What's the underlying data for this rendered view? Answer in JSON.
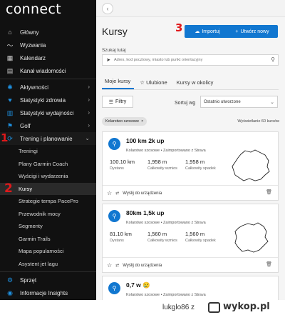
{
  "app": {
    "logo": "connect"
  },
  "sidebar": {
    "items": [
      {
        "label": "Główny",
        "icon": "home-icon",
        "glyph": "⌂"
      },
      {
        "label": "Wyzwania",
        "icon": "trend-icon",
        "glyph": "〜"
      },
      {
        "label": "Kalendarz",
        "icon": "calendar-icon",
        "glyph": "▦"
      },
      {
        "label": "Kanał wiadomości",
        "icon": "news-icon",
        "glyph": "▤"
      }
    ],
    "groups": [
      {
        "label": "Aktywności",
        "icon": "runner-icon",
        "glyph": "✱",
        "chevron": "›"
      },
      {
        "label": "Statystyki zdrowia",
        "icon": "heart-icon",
        "glyph": "♥",
        "chevron": "›"
      },
      {
        "label": "Statystyki wydajności",
        "icon": "chart-icon",
        "glyph": "▥",
        "chevron": "›"
      },
      {
        "label": "Golf",
        "icon": "golf-flag-icon",
        "glyph": "⚑",
        "chevron": "›"
      }
    ],
    "training": {
      "label": "Trening i planowanie",
      "icon": "training-icon",
      "glyph": "⟳",
      "chevron": "⌄",
      "marker": "1",
      "sub_items": [
        "Treningi",
        "Plany Garmin Coach",
        "Wyścigi i wydarzenia",
        "Kursy",
        "Strategie tempa PacePro",
        "Przewodnik mocy",
        "Segmenty",
        "Garmin Trails",
        "Mapa popularności",
        "Asystent jet lagu"
      ],
      "active_marker": "2"
    },
    "bottom": [
      {
        "label": "Sprzęt",
        "icon": "gear-icon",
        "glyph": "⚙"
      },
      {
        "label": "Informacje Insights",
        "icon": "insights-icon",
        "glyph": "◉"
      }
    ]
  },
  "topbar": {
    "back_glyph": "‹"
  },
  "page": {
    "title": "Kursy",
    "import_marker": "3",
    "import_label": "Importuj",
    "new_label": "Utwórz nowy",
    "new_glyph": "+",
    "import_glyph": "☁"
  },
  "search": {
    "label": "Szukaj tutaj",
    "placeholder": "Adres, kod pocztowy, miasto lub punkt orientacyjny",
    "loc_glyph": "➤",
    "lens_glyph": "⚲"
  },
  "tabs": [
    {
      "label": "Moje kursy",
      "active": true
    },
    {
      "label": "☆ Ulubione",
      "active": false
    },
    {
      "label": "Kursy w okolicy",
      "active": false
    }
  ],
  "filters": {
    "label": "Filtry",
    "glyph": "☰"
  },
  "sort": {
    "label": "Sortuj wg",
    "value": "Ostatnio utworzone",
    "chevron": "⌄"
  },
  "chip": {
    "label": "Kolarstwo szosowe",
    "close": "×"
  },
  "results": "Wyświetlanie 60 kursów",
  "courses": [
    {
      "name": "100 km 2k up",
      "meta": "Kolarstwo szosowe • Zaimportowano z Strava",
      "stats": [
        {
          "value": "100.10 km",
          "label": "Dystans"
        },
        {
          "value": "1,958 m",
          "label": "Całkowity wznios"
        },
        {
          "value": "1,958 m",
          "label": "Całkowity spadek"
        }
      ],
      "send": "Wyślij do urządzenia"
    },
    {
      "name": "80km 1,5k up",
      "meta": "Kolarstwo szosowe • Zaimportowano z Strava",
      "stats": [
        {
          "value": "81.10 km",
          "label": "Dystans"
        },
        {
          "value": "1,560 m",
          "label": "Całkowity wznios"
        },
        {
          "value": "1,560 m",
          "label": "Całkowity spadek"
        }
      ],
      "send": "Wyślij do urządzenia"
    },
    {
      "name": "0,7 w 😢",
      "meta": "Kolarstwo szosowe • Zaimportowano z Strava"
    }
  ],
  "card_icons": {
    "ride_glyph": "⚲",
    "star_glyph": "☆",
    "link_glyph": "⇄",
    "trash_glyph": "🗑"
  },
  "watermark": {
    "user": "lukglo86  z",
    "site": "wykop.pl"
  }
}
